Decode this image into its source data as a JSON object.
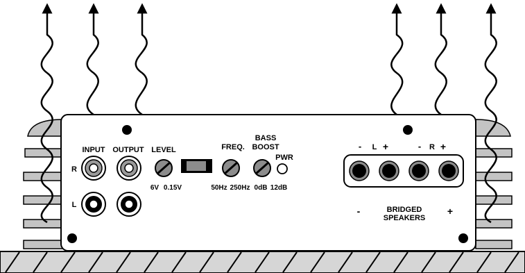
{
  "panel": {
    "input_label": "INPUT",
    "output_label": "OUTPUT",
    "level_label": "LEVEL",
    "channel_r": "R",
    "channel_l": "L",
    "level_min": "6V",
    "level_max": "0.15V",
    "freq_label": "FREQ.",
    "bass_boost_label_1": "BASS",
    "bass_boost_label_2": "BOOST",
    "pwr_label": "PWR",
    "freq_min": "50Hz",
    "freq_max": "250Hz",
    "boost_min": "0dB",
    "boost_max": "12dB"
  },
  "speakers": {
    "left_minus": "-",
    "left_label": "L",
    "left_plus": "+",
    "right_minus": "-",
    "right_label": "R",
    "right_plus": "+",
    "bridged_minus": "-",
    "bridged_label_1": "BRIDGED",
    "bridged_label_2": "SPEAKERS",
    "bridged_plus": "+"
  },
  "colors": {
    "panel_fill": "#ffffff",
    "heatsink": "#bfbfbf",
    "stroke": "#000000",
    "ground_hatch": "#bdbdbd"
  },
  "icons": {
    "heat_arrow": "wavy-up-arrow",
    "rca_jack": "rca-connector",
    "potentiometer": "slotted-knob",
    "speaker_terminal": "binding-post",
    "led": "power-led"
  }
}
